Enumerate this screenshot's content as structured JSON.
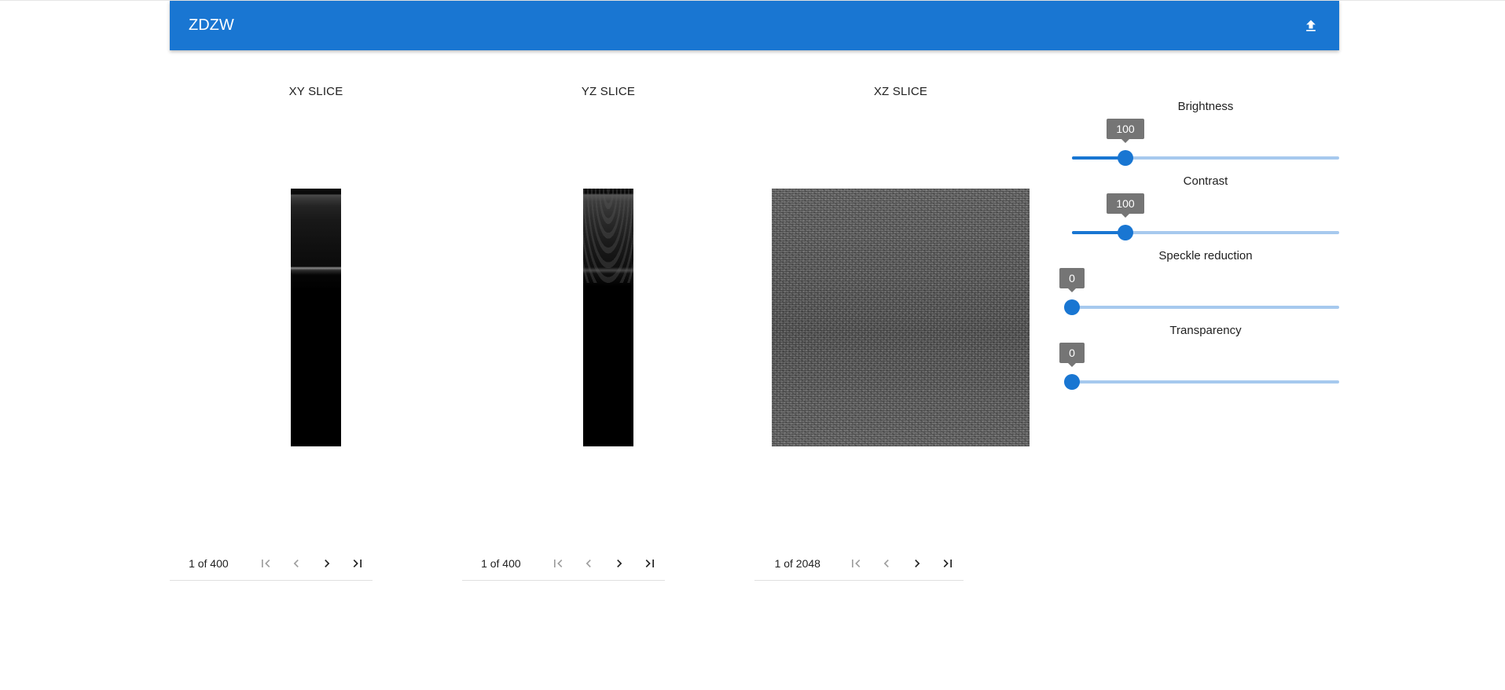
{
  "app": {
    "title": "ZDZW",
    "upload_icon": "upload-icon"
  },
  "slices": [
    {
      "title": "XY SLICE",
      "pager": "1 of 400"
    },
    {
      "title": "YZ SLICE",
      "pager": "1 of 400"
    },
    {
      "title": "XZ SLICE",
      "pager": "1 of 2048"
    }
  ],
  "sliders": [
    {
      "label": "Brightness",
      "value": "100",
      "fraction": 0.2
    },
    {
      "label": "Contrast",
      "value": "100",
      "fraction": 0.2
    },
    {
      "label": "Speckle reduction",
      "value": "0",
      "fraction": 0.0
    },
    {
      "label": "Transparency",
      "value": "0",
      "fraction": 0.0
    }
  ],
  "colors": {
    "primary": "#1976d2",
    "track": "#a6c9ee",
    "tooltip": "#757575"
  }
}
